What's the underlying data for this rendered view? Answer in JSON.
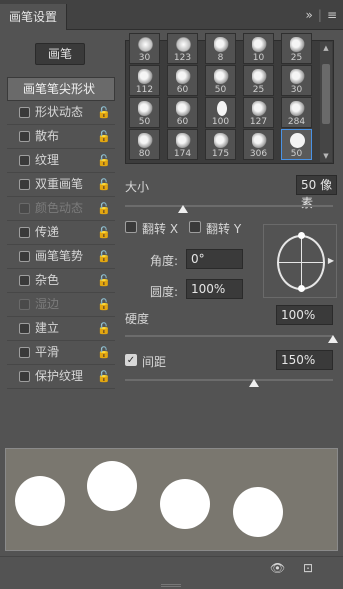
{
  "panel": {
    "title": "画笔设置",
    "menu_icons": [
      "double-chevron-right-icon",
      "hamburger-menu-icon"
    ]
  },
  "brush_button": "画笔",
  "options": [
    {
      "label": "画笔笔尖形状",
      "selected": true
    },
    {
      "label": "形状动态",
      "locked": true
    },
    {
      "label": "散布",
      "locked": true
    },
    {
      "label": "纹理",
      "locked": true
    },
    {
      "label": "双重画笔",
      "locked": true
    },
    {
      "label": "颜色动态",
      "locked": true,
      "disabled": true
    },
    {
      "label": "传递",
      "locked": true
    },
    {
      "label": "画笔笔势",
      "locked": true
    },
    {
      "label": "杂色",
      "locked": true
    },
    {
      "label": "湿边",
      "locked": true,
      "disabled": true
    },
    {
      "label": "建立",
      "locked": true
    },
    {
      "label": "平滑",
      "locked": true
    },
    {
      "label": "保护纹理",
      "locked": true
    }
  ],
  "brush_tips": [
    "30",
    "123",
    "8",
    "10",
    "25",
    "112",
    "60",
    "50",
    "25",
    "30",
    "50",
    "60",
    "100",
    "127",
    "284",
    "80",
    "174",
    "175",
    "306",
    "50"
  ],
  "size": {
    "label": "大小",
    "value": "50 像素",
    "slider_fraction": 0.28
  },
  "flip": {
    "x_label": "翻转 X",
    "y_label": "翻转 Y"
  },
  "angle": {
    "label": "角度:",
    "value": "0°"
  },
  "roundness": {
    "label": "圆度:",
    "value": "100%"
  },
  "hardness": {
    "label": "硬度",
    "value": "100%",
    "slider_fraction": 1.0
  },
  "spacing": {
    "label": "间距",
    "value": "150%",
    "checked": true,
    "slider_fraction": 0.62
  },
  "preview_dots": 4,
  "bottom_icons": [
    "visibility-toggle-icon",
    "new-brush-icon"
  ]
}
